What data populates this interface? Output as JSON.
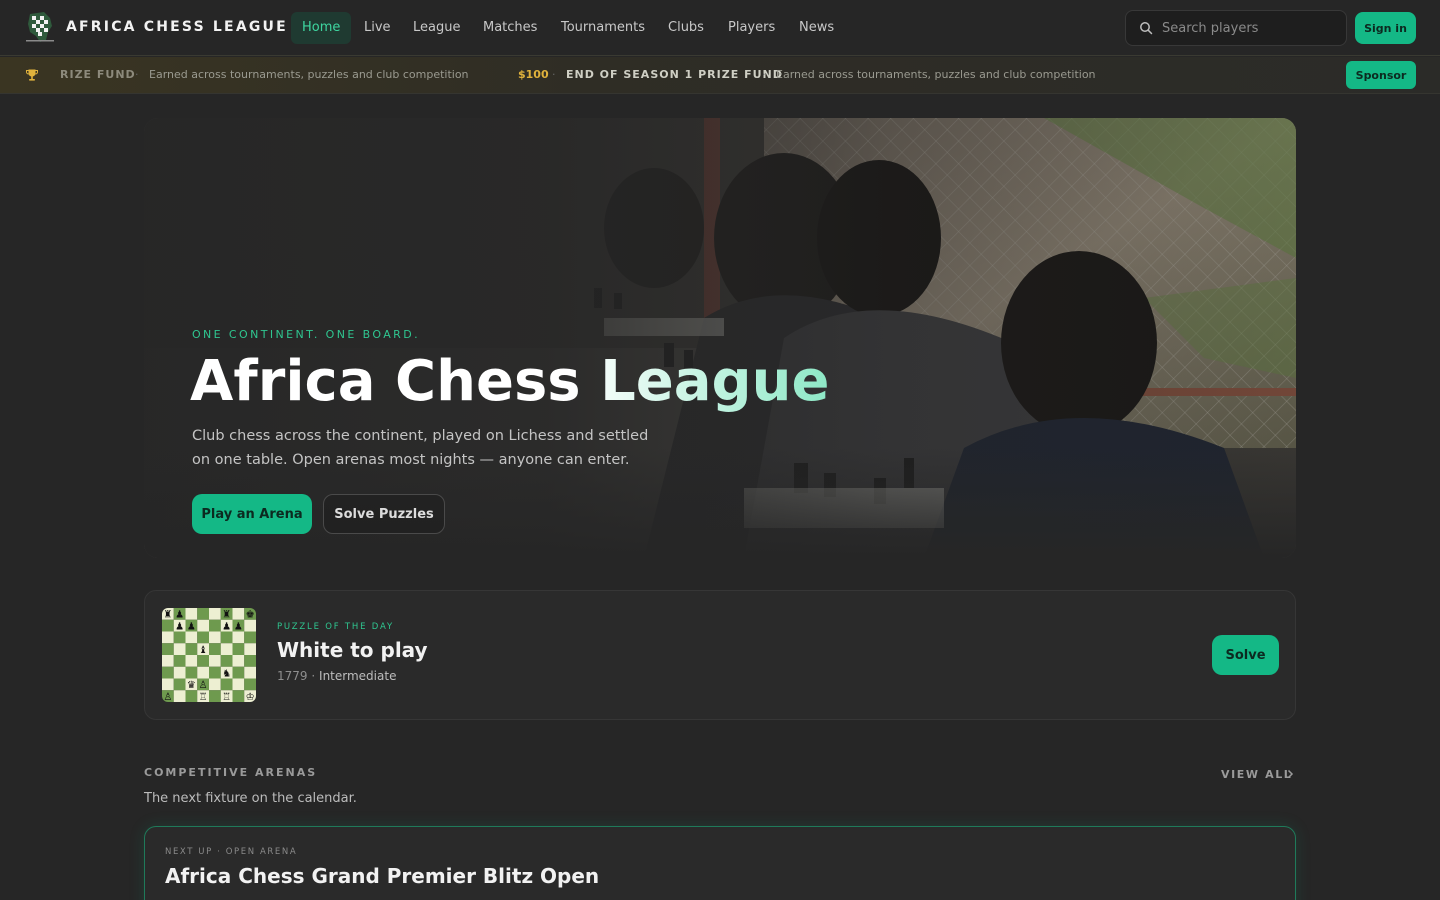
{
  "nav": {
    "brand": "AFRICA CHESS LEAGUE",
    "links": [
      {
        "label": "Home",
        "active": true
      },
      {
        "label": "Live"
      },
      {
        "label": "League"
      },
      {
        "label": "Matches"
      },
      {
        "label": "Tournaments"
      },
      {
        "label": "Clubs"
      },
      {
        "label": "Players"
      },
      {
        "label": "News"
      }
    ],
    "search_placeholder": "Search players",
    "signin_label": "Sign in"
  },
  "ticker": {
    "fragment_title": "RIZE FUND",
    "fragment_desc": "Earned across tournaments, puzzles and club competition",
    "amount": "$100",
    "title": "END OF SEASON 1 PRIZE FUND",
    "desc": "Earned across tournaments, puzzles and club competition",
    "separator": "·",
    "sponsor_label": "Sponsor"
  },
  "hero": {
    "eyebrow": "ONE CONTINENT. ONE BOARD.",
    "title": "Africa Chess League",
    "subtitle": "Club chess across the continent, played on Lichess and settled on one table. Open arenas most nights — anyone can enter.",
    "primary_cta": "Play an Arena",
    "secondary_cta": "Solve Puzzles"
  },
  "puzzle": {
    "eyebrow": "PUZZLE OF THE DAY",
    "title": "White to play",
    "rating": "1779",
    "separator": "·",
    "level": "Intermediate",
    "solve_label": "Solve"
  },
  "arenas": {
    "title": "COMPETITIVE ARENAS",
    "subtitle": "The next fixture on the calendar.",
    "view_all_label": "VIEW ALL",
    "next": {
      "eyebrow": "NEXT UP · OPEN ARENA",
      "title": "Africa Chess Grand Premier Blitz Open"
    }
  },
  "colors": {
    "accent": "#14b886",
    "accent_text": "#2fc690",
    "gold": "#e0b23c",
    "background": "#262626"
  }
}
